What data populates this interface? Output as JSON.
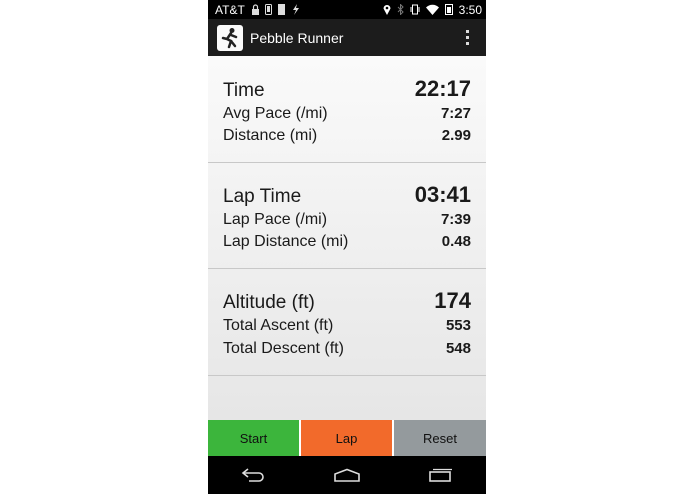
{
  "status_bar": {
    "carrier": "AT&T",
    "time": "3:50",
    "left_icons": [
      "lock-icon",
      "phone-icon",
      "sd-card-icon",
      "usb-icon"
    ],
    "right_icons": [
      "location-icon",
      "bluetooth-icon",
      "vibrate-icon",
      "wifi-icon",
      "battery-icon"
    ]
  },
  "action_bar": {
    "title": "Pebble Runner",
    "app_icon": "runner-icon",
    "menu_icon": "overflow-menu-icon"
  },
  "sections": [
    {
      "rows": [
        {
          "label": "Time",
          "value": "22:17"
        },
        {
          "label": "Avg Pace (/mi)",
          "value": "7:27"
        },
        {
          "label": "Distance (mi)",
          "value": "2.99"
        }
      ]
    },
    {
      "rows": [
        {
          "label": "Lap Time",
          "value": "03:41"
        },
        {
          "label": "Lap Pace (/mi)",
          "value": "7:39"
        },
        {
          "label": "Lap Distance (mi)",
          "value": "0.48"
        }
      ]
    },
    {
      "rows": [
        {
          "label": "Altitude (ft)",
          "value": "174"
        },
        {
          "label": "Total Ascent (ft)",
          "value": "553"
        },
        {
          "label": "Total Descent (ft)",
          "value": "548"
        }
      ]
    }
  ],
  "buttons": {
    "start": {
      "label": "Start",
      "color": "#3cb53c"
    },
    "lap": {
      "label": "Lap",
      "color": "#f26a2b"
    },
    "reset": {
      "label": "Reset",
      "color": "#949a9d"
    }
  },
  "nav_bar": {
    "icons": [
      "back-icon",
      "home-icon",
      "recent-apps-icon"
    ]
  }
}
